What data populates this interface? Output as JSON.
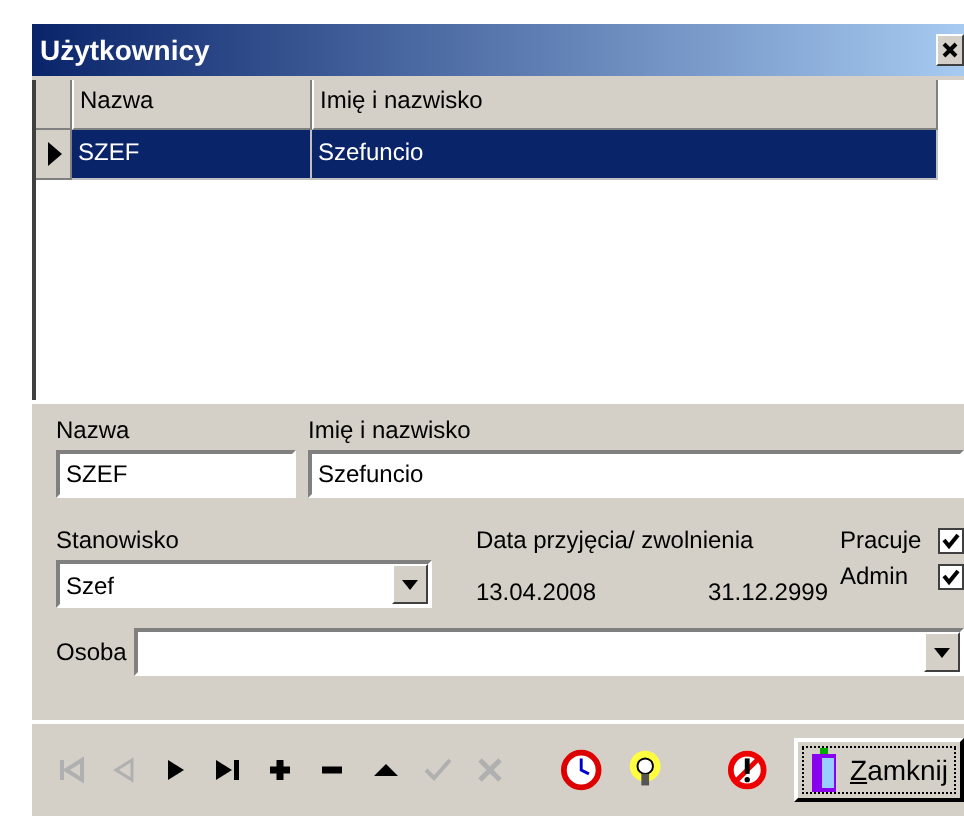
{
  "window": {
    "title": "Użytkownicy"
  },
  "grid": {
    "columns": [
      "Nazwa",
      "Imię i nazwisko"
    ],
    "rows": [
      {
        "cells": [
          "SZEF",
          "Szefuncio"
        ],
        "selected": true
      }
    ]
  },
  "form": {
    "name_label": "Nazwa",
    "name_value": "SZEF",
    "fullname_label": "Imię i nazwisko",
    "fullname_value": "Szefuncio",
    "position_label": "Stanowisko",
    "position_value": "Szef",
    "dates_label": "Data przyjęcia/ zwolnienia",
    "hire_date": "13.04.2008",
    "leave_date": "31.12.2999",
    "checkboxes": [
      {
        "label": "Pracuje",
        "checked": true
      },
      {
        "label": "Admin",
        "checked": true
      }
    ],
    "person_label": "Osoba"
  },
  "toolbar": {
    "nav": [
      {
        "kind": "first",
        "disabled": true
      },
      {
        "kind": "prior",
        "disabled": true
      },
      {
        "kind": "next",
        "disabled": false
      },
      {
        "kind": "last",
        "disabled": false
      },
      {
        "kind": "insert",
        "disabled": false
      },
      {
        "kind": "delete",
        "disabled": false
      },
      {
        "kind": "edit",
        "disabled": false
      },
      {
        "kind": "post",
        "disabled": true
      },
      {
        "kind": "cancel",
        "disabled": true
      }
    ],
    "close_button": "Zamknij"
  }
}
